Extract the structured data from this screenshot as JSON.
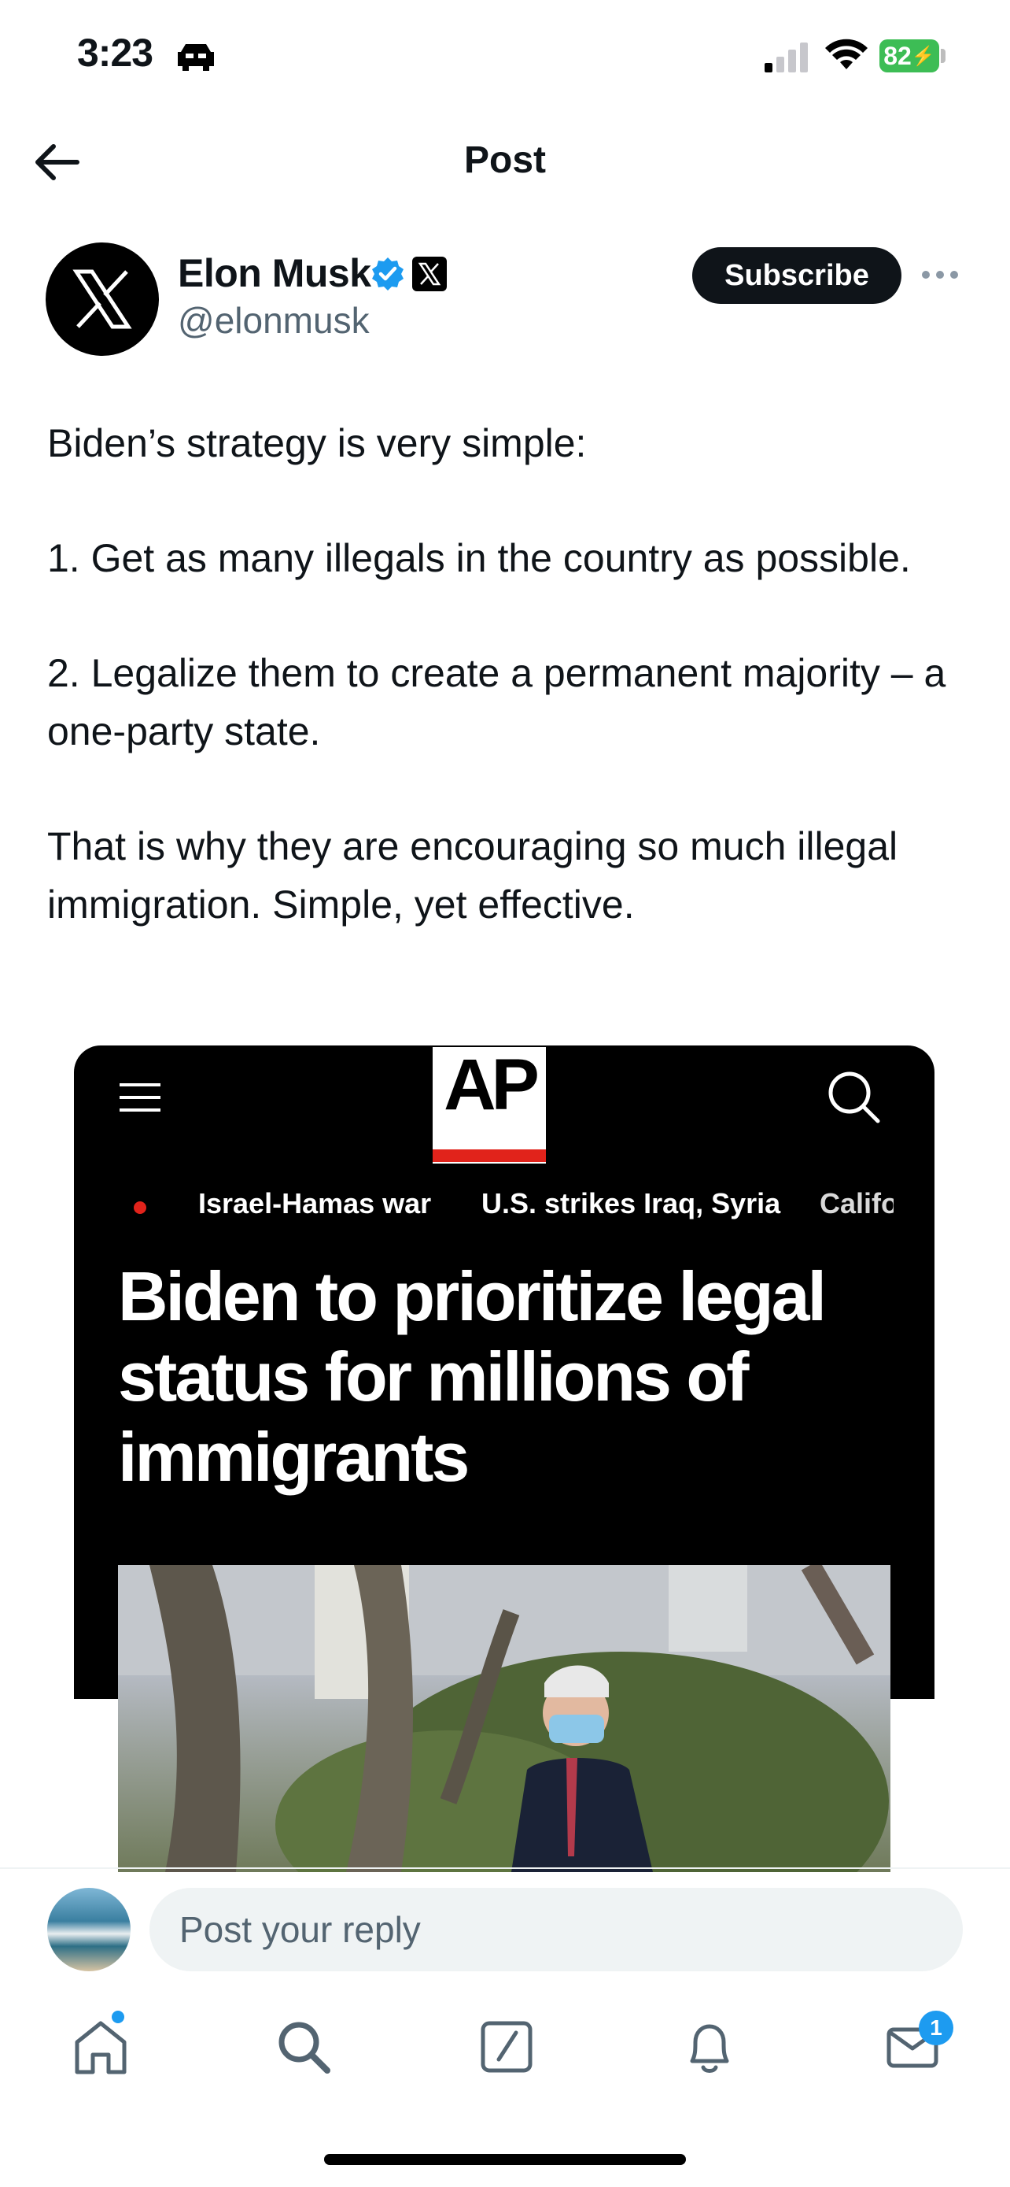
{
  "status_bar": {
    "time": "3:23",
    "battery": "82",
    "icons": [
      "car-icon",
      "signal-icon",
      "wifi-icon",
      "battery-icon"
    ]
  },
  "header": {
    "title": "Post",
    "back_icon": "arrow-left-icon"
  },
  "author": {
    "name": "Elon Musk",
    "handle": "@elonmusk",
    "verified_icon": "verified-badge-icon",
    "affiliation_icon": "x-logo-icon",
    "subscribe_label": "Subscribe",
    "more_icon": "more-horizontal-icon"
  },
  "tweet": {
    "paragraphs": [
      "Biden’s strategy is very simple:",
      "1. Get as many illegals in the country as possible.",
      "2. Legalize them to create a permanent majority – a one-party state.",
      "That is why they are encouraging so much illegal immigration. Simple, yet effective."
    ]
  },
  "media": {
    "logo": "AP",
    "menu_icon": "hamburger-menu-icon",
    "search_icon": "search-icon",
    "nav_links": [
      "Israel-Hamas war",
      "U.S. strikes Iraq, Syria",
      "Califo"
    ],
    "headline": "Biden to prioritize legal status for millions of immigrants",
    "photo_icon": "news-photo"
  },
  "reply": {
    "placeholder": "Post your reply"
  },
  "tab_bar": {
    "items": [
      "home-icon",
      "search-icon",
      "compose-icon",
      "notifications-icon",
      "messages-icon"
    ],
    "messages_badge": "1"
  },
  "colors": {
    "text": "#0f1419",
    "secondary": "#536471",
    "accent": "#1d9bf0",
    "ap_red": "#e1231b",
    "battery_green": "#3dbd55"
  }
}
